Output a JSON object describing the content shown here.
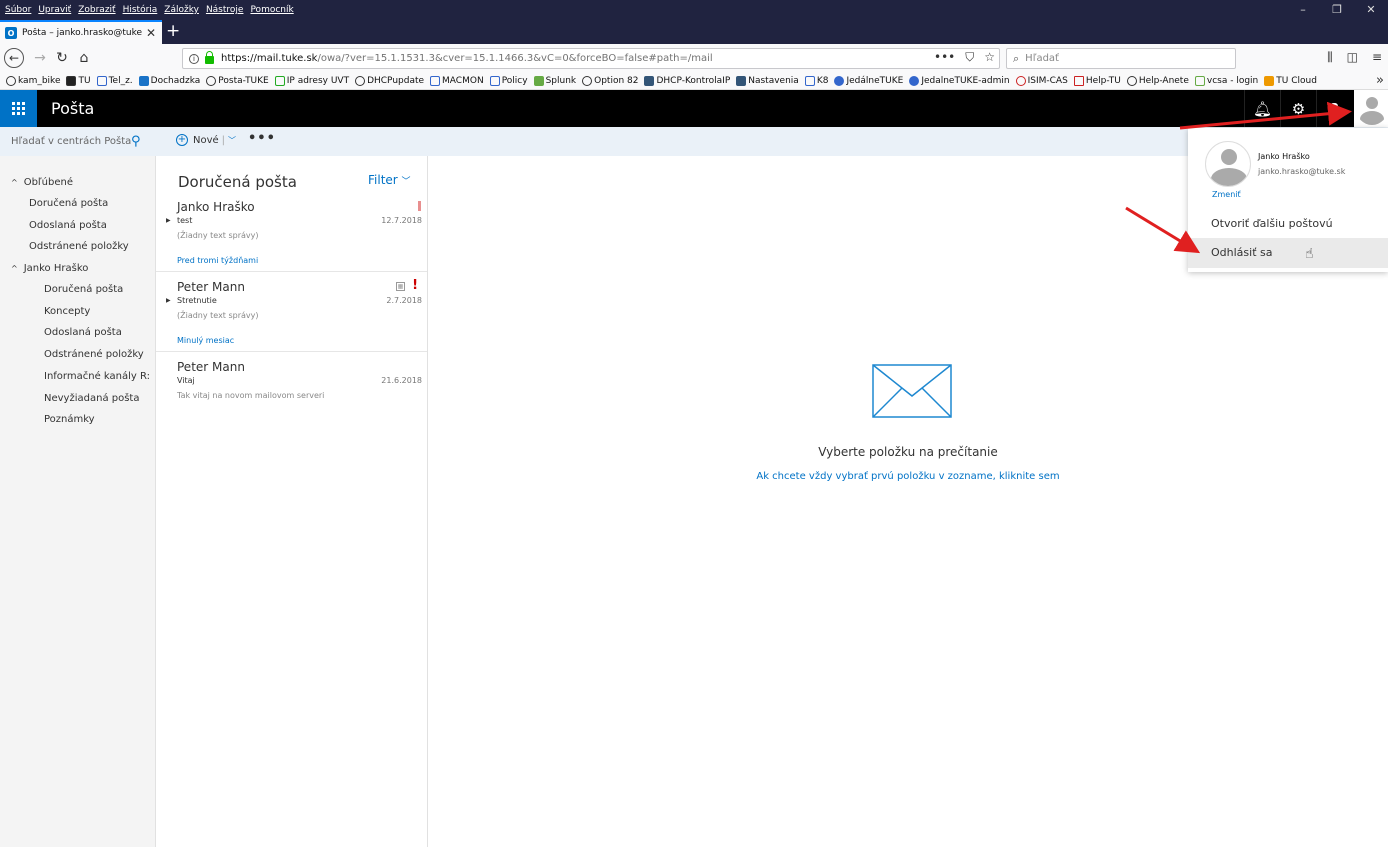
{
  "browser": {
    "menu": [
      "Súbor",
      "Upraviť",
      "Zobraziť",
      "História",
      "Záložky",
      "Nástroje",
      "Pomocník"
    ],
    "tab_title": "Pošta – janko.hrasko@tuke.sk",
    "url_host": "https://mail.tuke.sk",
    "url_path": "/owa/?ver=15.1.1531.3&cver=15.1.1466.3&vC=0&forceBO=false#path=/mail",
    "search_placeholder": "Hľadať",
    "bookmarks": [
      "kam_bike",
      "TU",
      "Tel_z.",
      "Dochadzka",
      "Posta-TUKE",
      "IP adresy UVT",
      "DHCPupdate",
      "MACMON",
      "Policy",
      "Splunk",
      "Option 82",
      "DHCP-KontrolaIP",
      "Nastavenia",
      "K8",
      "JedálneTUKE",
      "JedalneTUKE-admin",
      "ISIM-CAS",
      "Help-TU",
      "Help-Anete",
      "vcsa - login",
      "TU Cloud"
    ]
  },
  "owa": {
    "app_title": "Pošta",
    "search_placeholder": "Hľadať v centrách Pošta a...",
    "new_label": "Nové",
    "favorites_label": "Obľúbené",
    "favorites": [
      "Doručená pošta",
      "Odoslaná pošta",
      "Odstránené položky"
    ],
    "account_label": "Janko Hraško",
    "folders": [
      "Doručená pošta",
      "Koncepty",
      "Odoslaná pošta",
      "Odstránené položky",
      "Informačné kanály R:",
      "Nevyžiadaná pošta",
      "Poznámky"
    ],
    "list_title": "Doručená pošta",
    "filter_label": "Filter",
    "messages": [
      {
        "from": "Janko Hraško",
        "subject": "test",
        "date": "12.7.2018",
        "preview": "(Žiadny text správy)"
      },
      {
        "from": "Peter Mann",
        "subject": "Stretnutie",
        "date": "2.7.2018",
        "preview": "(Žiadny text správy)"
      },
      {
        "from": "Peter Mann",
        "subject": "Vitaj",
        "date": "21.6.2018",
        "preview": "Tak vitaj na novom mailovom serveri"
      }
    ],
    "groups": [
      "Pred tromi týždňami",
      "Minulý mesiac"
    ],
    "empty_title": "Vyberte položku na prečítanie",
    "empty_link": "Ak chcete vždy vybrať prvú položku v zozname, kliknite sem",
    "profile": {
      "name": "Janko Hraško",
      "email": "janko.hrasko@tuke.sk",
      "change": "Zmeniť",
      "open_other": "Otvoriť ďalšiu poštovú schránku...",
      "sign_out": "Odhlásiť sa"
    }
  },
  "colors": {
    "brand": "#0072c6",
    "annotation_arrow": "#e02020"
  }
}
